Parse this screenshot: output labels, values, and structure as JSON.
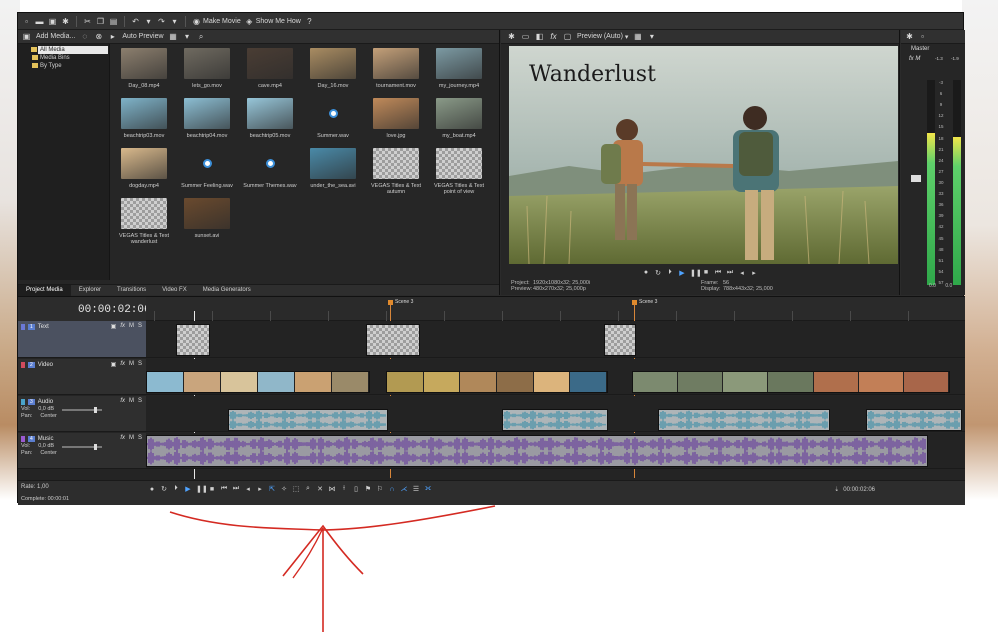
{
  "toolbar": {
    "make_movie": "Make Movie",
    "show_me_how": "Show Me How"
  },
  "media_panel": {
    "add_media": "Add Media...",
    "auto_preview": "Auto Preview",
    "tree": [
      {
        "label": "All Media",
        "selected": true
      },
      {
        "label": "Media Bins",
        "selected": false
      },
      {
        "label": "By Type",
        "selected": false
      }
    ],
    "items": [
      {
        "caption": "Day_08.mp4",
        "kind": "video",
        "color": "#8c7f6e"
      },
      {
        "caption": "lets_go.mov",
        "kind": "video",
        "color": "#6f6a60"
      },
      {
        "caption": "cave.mp4",
        "kind": "video",
        "color": "#4a3d34"
      },
      {
        "caption": "Day_16.mov",
        "kind": "video",
        "color": "#a98c62"
      },
      {
        "caption": "tournament.mov",
        "kind": "video",
        "color": "#c4a079"
      },
      {
        "caption": "my_journey.mp4",
        "kind": "video",
        "color": "#7c9aa3"
      },
      {
        "caption": "beachtrip03.mov",
        "kind": "video",
        "color": "#7fb3c9"
      },
      {
        "caption": "beachtrip04.mov",
        "kind": "video",
        "color": "#8cbed3"
      },
      {
        "caption": "beachtrip05.mov",
        "kind": "video",
        "color": "#97c6d9"
      },
      {
        "caption": "Summer.wav",
        "kind": "audio",
        "color": "#262626"
      },
      {
        "caption": "love.jpg",
        "kind": "video",
        "color": "#c08a5a"
      },
      {
        "caption": "my_boat.mp4",
        "kind": "video",
        "color": "#8a9a88"
      },
      {
        "caption": "dogday.mp4",
        "kind": "video",
        "color": "#d9b98c"
      },
      {
        "caption": "Summer Feeling.wav",
        "kind": "audio",
        "color": "#262626"
      },
      {
        "caption": "Summer Themes.wav",
        "kind": "audio",
        "color": "#262626"
      },
      {
        "caption": "under_the_sea.avi",
        "kind": "video",
        "color": "#4a8aa8"
      },
      {
        "caption": "VEGAS Titles & Text autumn",
        "kind": "checker",
        "color": "#cfcfcf"
      },
      {
        "caption": "VEGAS Titles & Text point of view",
        "kind": "checker",
        "color": "#cfcfcf"
      },
      {
        "caption": "VEGAS Titles & Text wanderlust",
        "kind": "checker",
        "color": "#cfcfcf"
      },
      {
        "caption": "sunset.avi",
        "kind": "video",
        "color": "#6a4a2e"
      }
    ],
    "tabs": [
      "Project Media",
      "Explorer",
      "Transitions",
      "Video FX",
      "Media Generators"
    ]
  },
  "preview": {
    "mode": "Preview (Auto)",
    "overlay_title": "Wanderlust",
    "project_label": "Project:",
    "project_value": "1920x1080x32; 25,000i",
    "preview_label": "Preview:",
    "preview_value": "480x270x32; 25,000p",
    "frame_label": "Frame:",
    "frame_value": "56",
    "display_label": "Display:",
    "display_value": "788x443x32; 25,000"
  },
  "master": {
    "label": "Master",
    "scale": [
      "-3",
      "6",
      "9",
      "12",
      "15",
      "18",
      "21",
      "24",
      "27",
      "30",
      "33",
      "36",
      "39",
      "42",
      "45",
      "48",
      "51",
      "54",
      "57"
    ],
    "left_readout": "-1.3",
    "right_readout": "-1.9",
    "foot_left": "0.0",
    "foot_right": "0.0",
    "level_left": 0.74,
    "level_right": 0.72
  },
  "timeline": {
    "timecode": "00:00:02:06",
    "markers": [
      "Scene 3",
      "Scene 3"
    ],
    "tracks": [
      {
        "num": "1",
        "name": "Text",
        "color": "#6b79d6"
      },
      {
        "num": "2",
        "name": "Video",
        "color": "#d04b5c"
      },
      {
        "num": "3",
        "name": "Audio",
        "color": "#4aa3c9",
        "vol_label": "Vol:",
        "vol": "0,0 dB",
        "pan_label": "Pan:",
        "pan": "Center"
      },
      {
        "num": "4",
        "name": "Music",
        "color": "#9a5ad0",
        "vol_label": "Vol:",
        "vol": "0,0 dB",
        "pan_label": "Pan:",
        "pan": "Center"
      }
    ],
    "rate_label": "Rate: 1,00",
    "complete_label": "Complete: 00:00:01",
    "cursor_time": "00:00:02:06"
  }
}
